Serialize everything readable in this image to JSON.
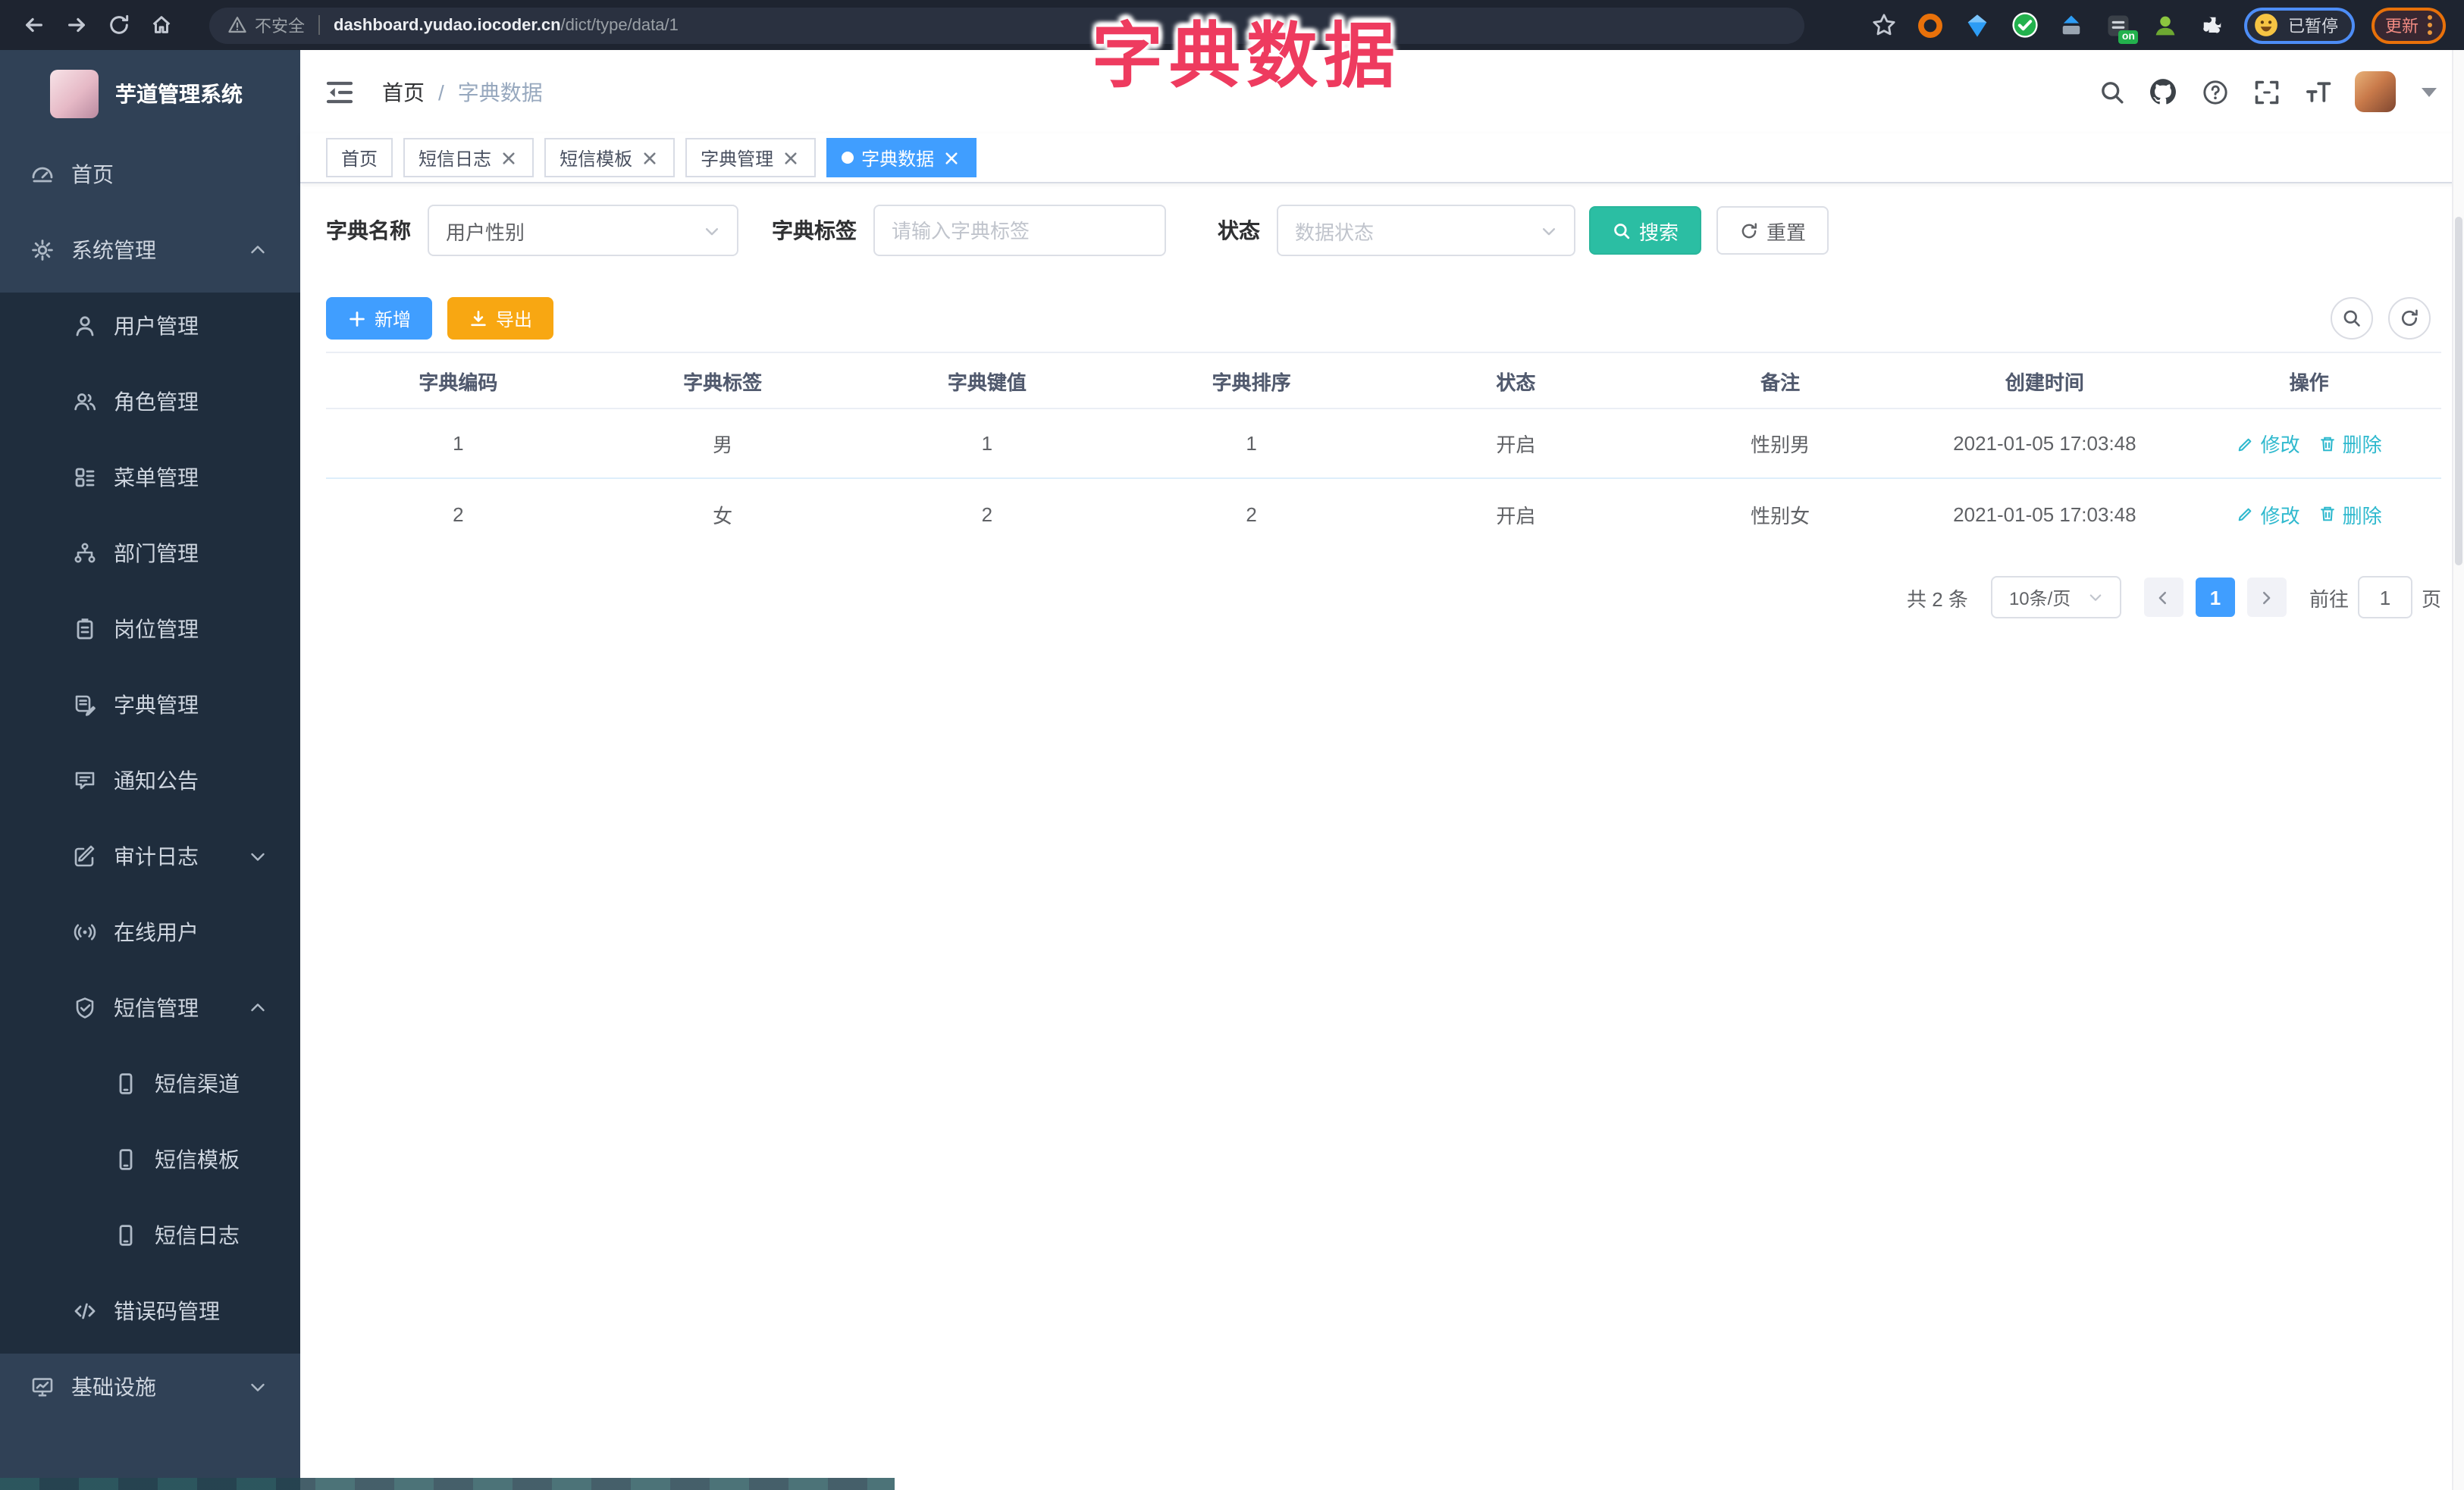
{
  "annotation": {
    "title": "字典数据"
  },
  "browser": {
    "security_label": "不安全",
    "url_host": "dashboard.yudao.iocoder.cn",
    "url_path": "/dict/type/data/1",
    "extension_badge": "on",
    "profile_status": "已暂停",
    "update_label": "更新"
  },
  "sidebar": {
    "app_title": "芋道管理系统",
    "items": [
      {
        "label": "首页"
      },
      {
        "label": "系统管理"
      },
      {
        "label": "用户管理"
      },
      {
        "label": "角色管理"
      },
      {
        "label": "菜单管理"
      },
      {
        "label": "部门管理"
      },
      {
        "label": "岗位管理"
      },
      {
        "label": "字典管理"
      },
      {
        "label": "通知公告"
      },
      {
        "label": "审计日志"
      },
      {
        "label": "在线用户"
      },
      {
        "label": "短信管理"
      },
      {
        "label": "短信渠道"
      },
      {
        "label": "短信模板"
      },
      {
        "label": "短信日志"
      },
      {
        "label": "错误码管理"
      },
      {
        "label": "基础设施"
      }
    ]
  },
  "header": {
    "breadcrumb_home": "首页",
    "breadcrumb_sep": "/",
    "breadcrumb_current": "字典数据"
  },
  "tabs": [
    {
      "label": "首页"
    },
    {
      "label": "短信日志"
    },
    {
      "label": "短信模板"
    },
    {
      "label": "字典管理"
    },
    {
      "label": "字典数据"
    }
  ],
  "filters": {
    "dict_name_label": "字典名称",
    "dict_name_value": "用户性别",
    "dict_label_label": "字典标签",
    "dict_label_placeholder": "请输入字典标签",
    "status_label": "状态",
    "status_placeholder": "数据状态",
    "search_label": "搜索",
    "reset_label": "重置"
  },
  "toolbar": {
    "add_label": "新增",
    "export_label": "导出"
  },
  "table": {
    "columns": [
      "字典编码",
      "字典标签",
      "字典键值",
      "字典排序",
      "状态",
      "备注",
      "创建时间",
      "操作"
    ],
    "actions": {
      "edit": "修改",
      "delete": "删除"
    },
    "rows": [
      {
        "code": "1",
        "label": "男",
        "value": "1",
        "sort": "1",
        "status": "开启",
        "remark": "性别男",
        "created": "2021-01-05 17:03:48"
      },
      {
        "code": "2",
        "label": "女",
        "value": "2",
        "sort": "2",
        "status": "开启",
        "remark": "性别女",
        "created": "2021-01-05 17:03:48"
      }
    ]
  },
  "pagination": {
    "total": "共 2 条",
    "page_size": "10条/页",
    "page": "1",
    "goto_label": "前往",
    "goto_value": "1",
    "page_unit": "页"
  },
  "colors": {
    "primary": "#409EFF",
    "search_teal": "#2BBEA3",
    "export_orange": "#F8A712",
    "link_cyan": "#2FB9CE",
    "annotation_pink": "#EE3B5F",
    "sidebar_dark": "#1f2d3d",
    "sidebar_light": "#304156"
  }
}
